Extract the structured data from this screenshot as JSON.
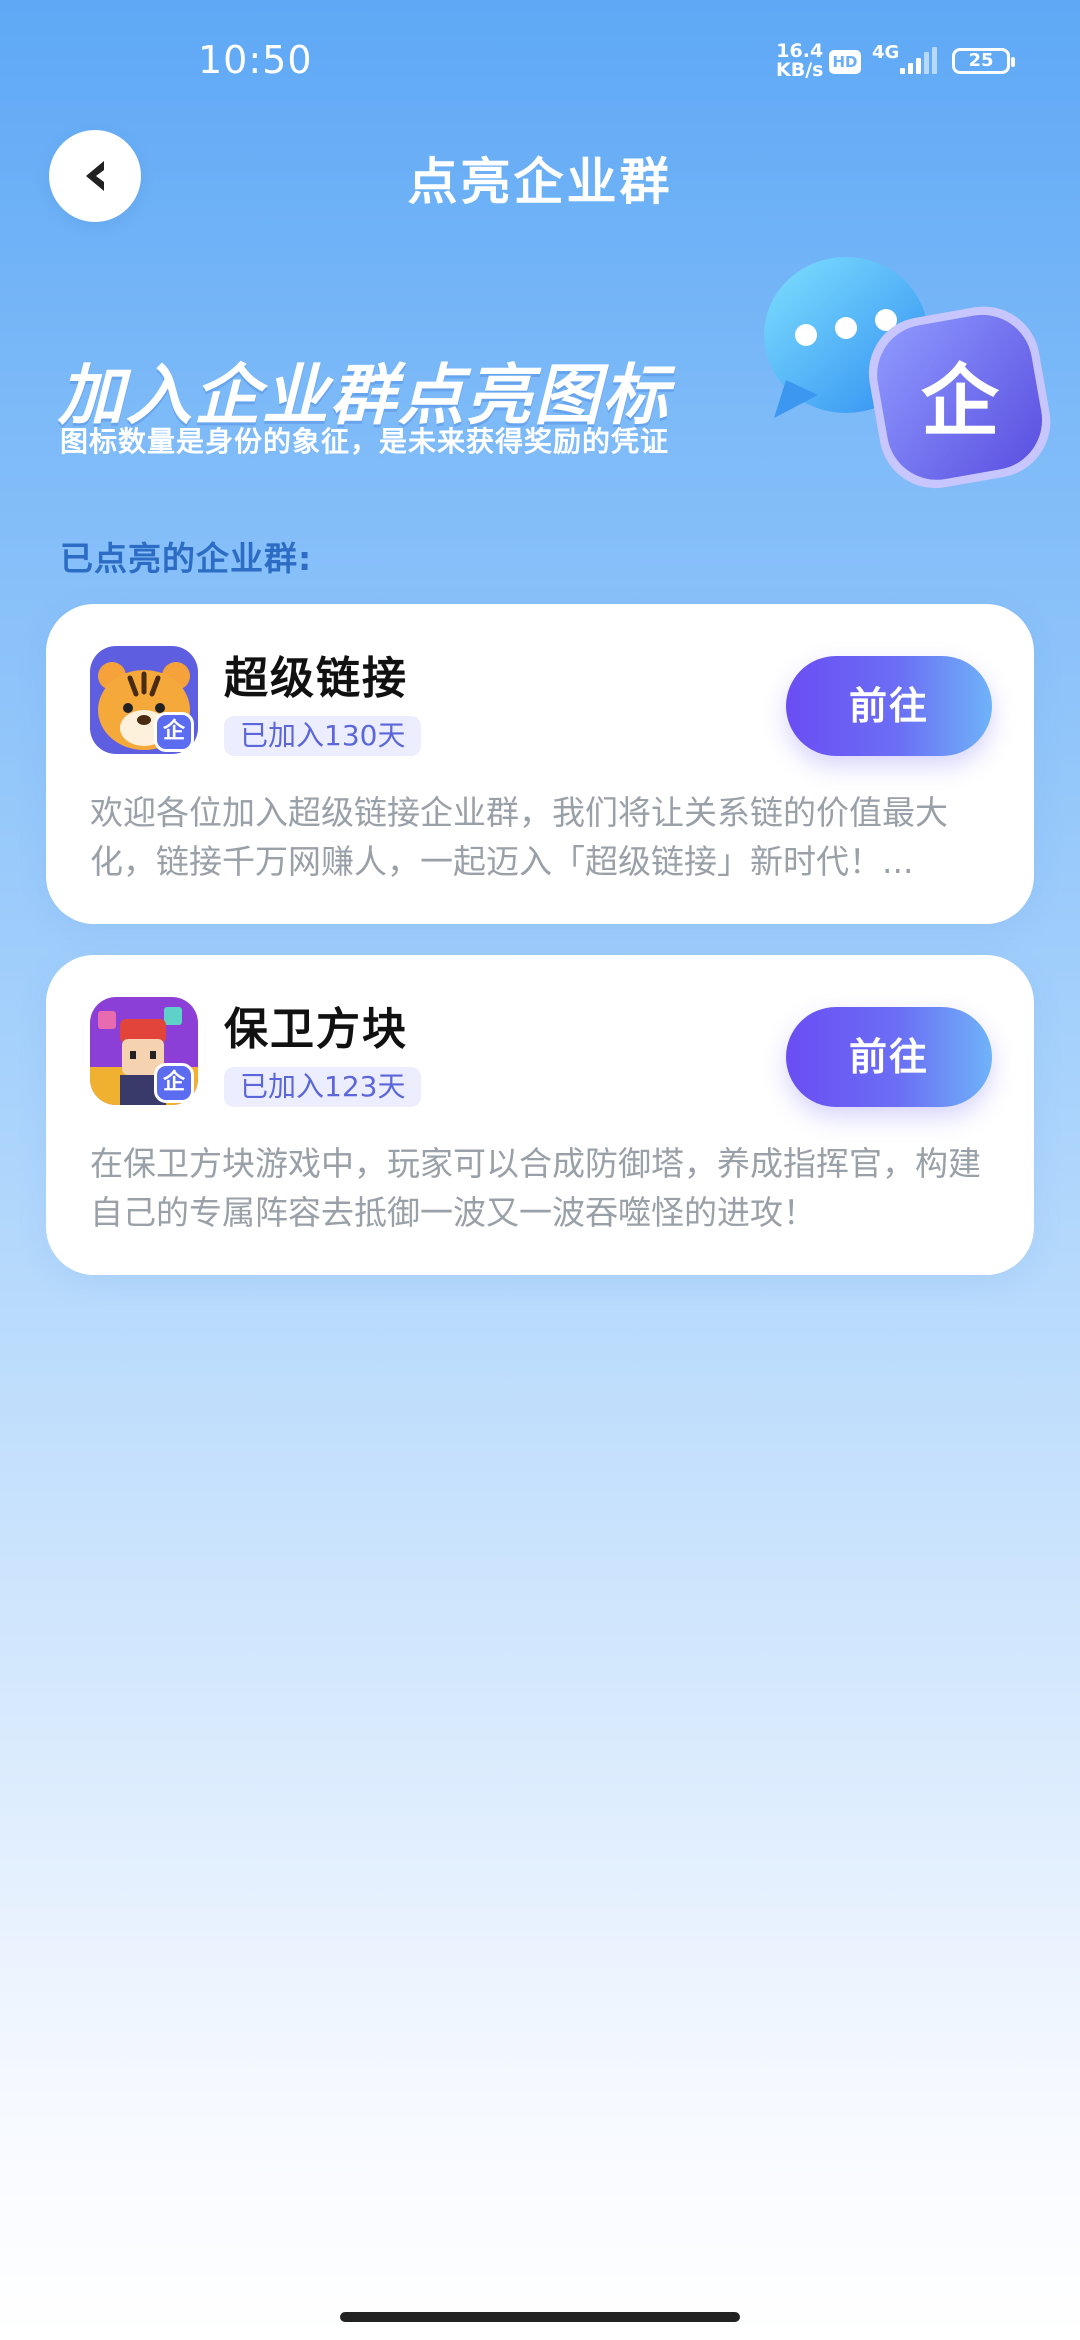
{
  "status_bar": {
    "time": "10:50",
    "speed_value": "16.4",
    "speed_unit": "KB/s",
    "hd": "HD",
    "network": "4G",
    "battery": "25"
  },
  "header": {
    "title": "点亮企业群"
  },
  "hero": {
    "headline": "加入企业群点亮图标",
    "subtitle": "图标数量是身份的象征，是未来获得奖励的凭证",
    "icon_glyph": "企"
  },
  "section": {
    "label": "已点亮的企业群:"
  },
  "groups": [
    {
      "title": "超级链接",
      "joined": "已加入130天",
      "button": "前往",
      "badge": "企",
      "description": "欢迎各位加入超级链接企业群，我们将让关系链的价值最大化，链接千万网赚人，一起迈入「超级链接」新时代！..."
    },
    {
      "title": "保卫方块",
      "joined": "已加入123天",
      "button": "前往",
      "badge": "企",
      "description": "在保卫方块游戏中，玩家可以合成防御塔，养成指挥官，构建自己的专属阵容去抵御一波又一波吞噬怪的进攻！"
    }
  ],
  "colors": {
    "accent_purple": "#6a4df3",
    "section_label": "#2c6cc4",
    "badge_bg": "#eceeff",
    "badge_text": "#5b67d8"
  }
}
